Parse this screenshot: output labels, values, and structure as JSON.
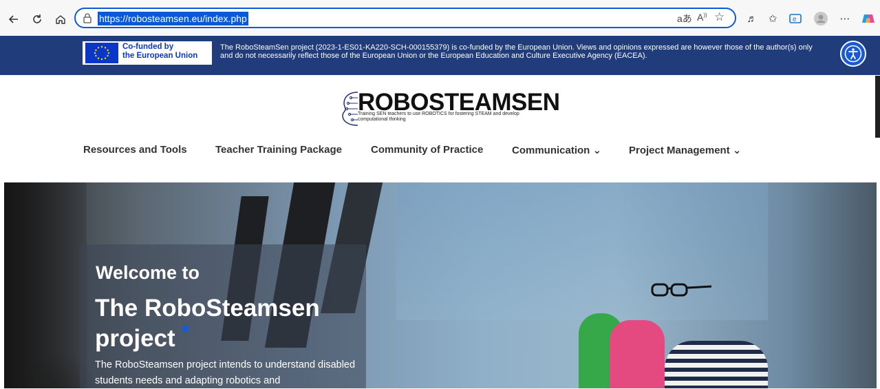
{
  "browser": {
    "url": "https://robosteamsen.eu/index.php"
  },
  "eu_banner": {
    "logo_line1": "Co-funded by",
    "logo_line2": "the European Union",
    "notice": "The RoboSteamSen project (2023-1-ES01-KA220-SCH-000155379) is co-funded by the European Union. Views and opinions expressed are however those of the author(s) only and do not necessarily reflect those of the European Union or the European Education and Culture Executive Agency (EACEA)."
  },
  "header": {
    "logo_title": "ROBOSTEAMSEN",
    "logo_subtitle": "Training SEN teachers to use ROBOTICS for fostering STEAM and develop computational thinking"
  },
  "menu": {
    "items": [
      {
        "label": "Resources and Tools"
      },
      {
        "label": "Teacher Training Package"
      },
      {
        "label": "Community of Practice"
      },
      {
        "label": "Communication ⌄"
      },
      {
        "label": "Project Management ⌄"
      }
    ]
  },
  "hero": {
    "welcome": "Welcome to",
    "title": "The RoboSteamsen project",
    "description": "The RoboSteamsen project intends to understand disabled students needs and adapting robotics and"
  },
  "colors": {
    "eu_banner_bg": "#213c7a",
    "accent": "#1a5bd4",
    "address_highlight": "#0a59d8"
  }
}
